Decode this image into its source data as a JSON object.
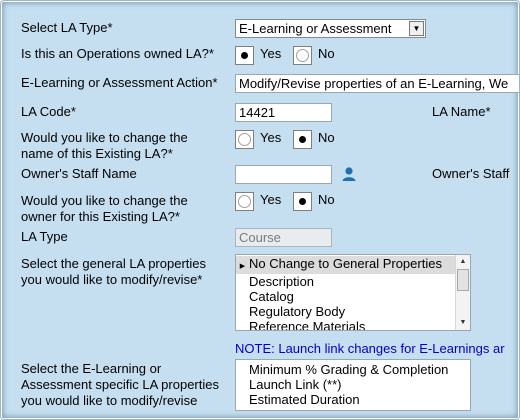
{
  "form": {
    "la_type": {
      "label": "Select LA Type*",
      "value": "E-Learning or Assessment"
    },
    "ops_owned": {
      "label": "Is this an Operations owned LA?*",
      "yes": "Yes",
      "no": "No",
      "selected": "yes"
    },
    "action": {
      "label": "E-Learning or Assessment Action*",
      "value": "Modify/Revise properties of an E-Learning, We"
    },
    "la_code": {
      "label": "LA Code*",
      "value": "14421"
    },
    "la_name": {
      "label": "LA Name*"
    },
    "change_name": {
      "label_line1": "Would you like to change the",
      "label_line2": "name of this Existing LA?*",
      "yes": "Yes",
      "no": "No",
      "selected": "no"
    },
    "owner_staff_name": {
      "label": "Owner's Staff Name",
      "value": ""
    },
    "owner_staff_right": {
      "label": "Owner's Staff"
    },
    "change_owner": {
      "label_line1": "Would you like to change the",
      "label_line2": "owner for this Existing LA?*",
      "yes": "Yes",
      "no": "No",
      "selected": "no"
    },
    "la_type_field": {
      "label": "LA Type",
      "value": "Course"
    },
    "general_props": {
      "label_line1": "Select the general LA properties",
      "label_line2": "you would like to modify/revise*",
      "options": [
        "No Change to General Properties",
        "Description",
        "Catalog",
        "Regulatory Body",
        "Reference Materials"
      ]
    },
    "note": "NOTE: Launch link changes for E-Learnings ar",
    "specific_props": {
      "label_line1": "Select the E-Learning or",
      "label_line2": "Assessment specific LA properties",
      "label_line3": "you would like to modify/revise",
      "options": [
        "Minimum % Grading & Completion",
        "Launch Link (**)",
        "Estimated Duration"
      ]
    }
  },
  "colors": {
    "panel_bg": "#c5dff0",
    "note_text": "#0000cc"
  },
  "icons": {
    "staff_lookup": "person-search-icon",
    "dropdown": "chevron-down-icon"
  }
}
